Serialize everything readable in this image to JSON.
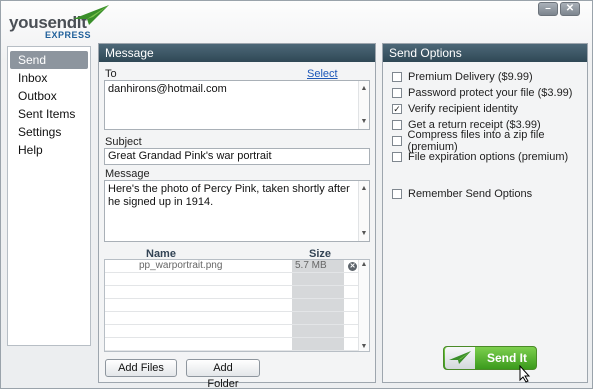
{
  "app": {
    "logo_main": "yousendit",
    "logo_sub": "EXPRESS",
    "minimize_label": "–",
    "close_label": "✕"
  },
  "nav": {
    "items": [
      "Send",
      "Inbox",
      "Outbox",
      "Sent Items",
      "Settings",
      "Help"
    ],
    "active": "Send"
  },
  "message": {
    "header": "Message",
    "to_label": "To",
    "select_contacts": "Select Contacts",
    "to_value": "danhirons@hotmail.com",
    "subject_label": "Subject",
    "subject_value": "Great Grandad Pink's war portrait",
    "message_label": "Message",
    "message_value": "Here's the photo of Percy Pink, taken shortly after he signed up in 1914.",
    "files_columns": [
      "Name",
      "Size"
    ],
    "files": [
      {
        "name": "pp_warportrait.png",
        "size": "5.7 MB"
      }
    ],
    "add_files": "Add Files",
    "add_folder": "Add Folder"
  },
  "options": {
    "header": "Send Options",
    "items": [
      {
        "label": "Premium Delivery ($9.99)",
        "checked": false
      },
      {
        "label": "Password protect your file ($3.99)",
        "checked": false
      },
      {
        "label": "Verify recipient identity",
        "checked": true
      },
      {
        "label": "Get a return receipt ($3.99)",
        "checked": false
      },
      {
        "label": "Compress files into a zip file (premium)",
        "checked": false
      },
      {
        "label": "File expiration options (premium)",
        "checked": false
      }
    ],
    "remember": {
      "label": "Remember Send Options",
      "checked": false
    },
    "send_button": "Send It"
  },
  "colors": {
    "panel_header": "#3a5563",
    "send_green": "#4caf2a",
    "link_blue": "#1b56b8"
  }
}
